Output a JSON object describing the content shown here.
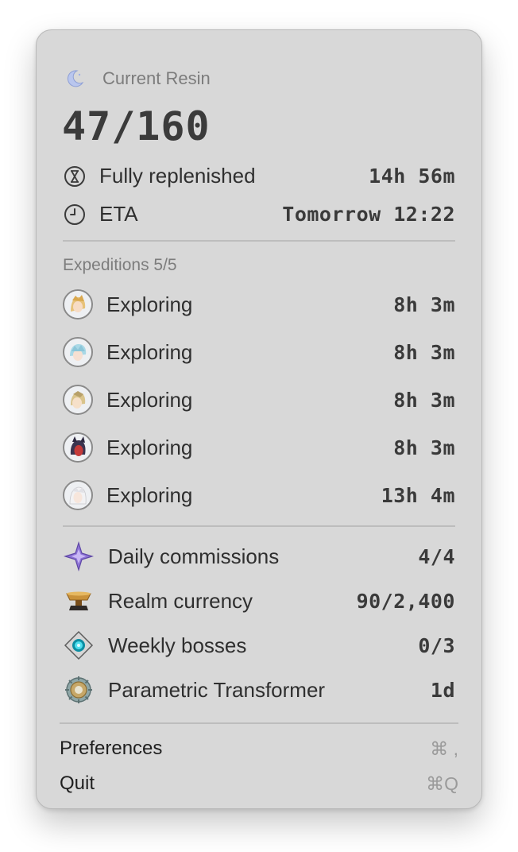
{
  "resin": {
    "header_label": "Current Resin",
    "header_icon": "moon-icon",
    "amount": "47/160",
    "rows": [
      {
        "icon": "hourglass-icon",
        "label": "Fully replenished",
        "value": "14h 56m"
      },
      {
        "icon": "clock-icon",
        "label": "ETA",
        "value": "Tomorrow 12:22"
      }
    ]
  },
  "expeditions": {
    "header": "Expeditions 5/5",
    "items": [
      {
        "icon": "character-avatar-icon",
        "status": "Exploring",
        "time": "8h 3m"
      },
      {
        "icon": "character-avatar-icon",
        "status": "Exploring",
        "time": "8h 3m"
      },
      {
        "icon": "character-avatar-icon",
        "status": "Exploring",
        "time": "8h 3m"
      },
      {
        "icon": "character-avatar-icon",
        "status": "Exploring",
        "time": "8h 3m"
      },
      {
        "icon": "character-avatar-icon",
        "status": "Exploring",
        "time": "13h 4m"
      }
    ]
  },
  "progress": {
    "items": [
      {
        "icon": "daily-commission-icon",
        "label": "Daily commissions",
        "value": "4/4"
      },
      {
        "icon": "realm-currency-icon",
        "label": "Realm currency",
        "value": "90/2,400"
      },
      {
        "icon": "weekly-boss-icon",
        "label": "Weekly bosses",
        "value": "0/3"
      },
      {
        "icon": "parametric-transformer-icon",
        "label": "Parametric Transformer",
        "value": "1d"
      }
    ]
  },
  "menu": {
    "preferences_label": "Preferences",
    "preferences_shortcut": "⌘ ,",
    "quit_label": "Quit",
    "quit_shortcut": "⌘Q"
  }
}
